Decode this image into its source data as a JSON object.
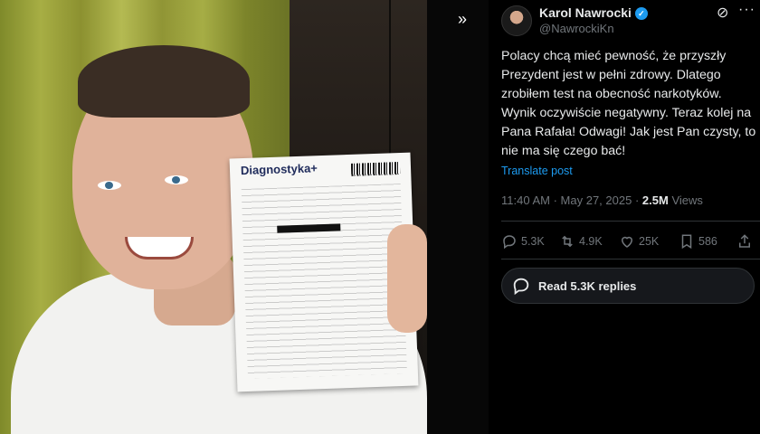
{
  "photo": {
    "document_brand": "Diagnostyka+",
    "expand_icon": "chevrons-right-icon"
  },
  "tweet": {
    "display_name": "Karol Nawrocki",
    "handle": "@NawrockiKn",
    "text": "Polacy chcą mieć pewność, że przyszły Prezydent jest w pełni zdrowy. Dlatego zrobiłem test na obecność narkotyków. Wynik oczywiście negatywny. Teraz kolej na Pana Rafała! Odwagi! Jak jest Pan czysty, to nie ma się czego bać!",
    "translate_label": "Translate post",
    "time": "11:40 AM",
    "date": "May 27, 2025",
    "views_count": "2.5M",
    "views_label": "Views",
    "actions": {
      "replies": "5.3K",
      "reposts": "4.9K",
      "likes": "25K",
      "bookmarks": "586"
    },
    "read_replies_label": "Read 5.3K replies"
  },
  "colors": {
    "accent": "#1d9bf0",
    "background": "#000000",
    "text_primary": "#e7e9ea",
    "text_secondary": "#71767b"
  }
}
